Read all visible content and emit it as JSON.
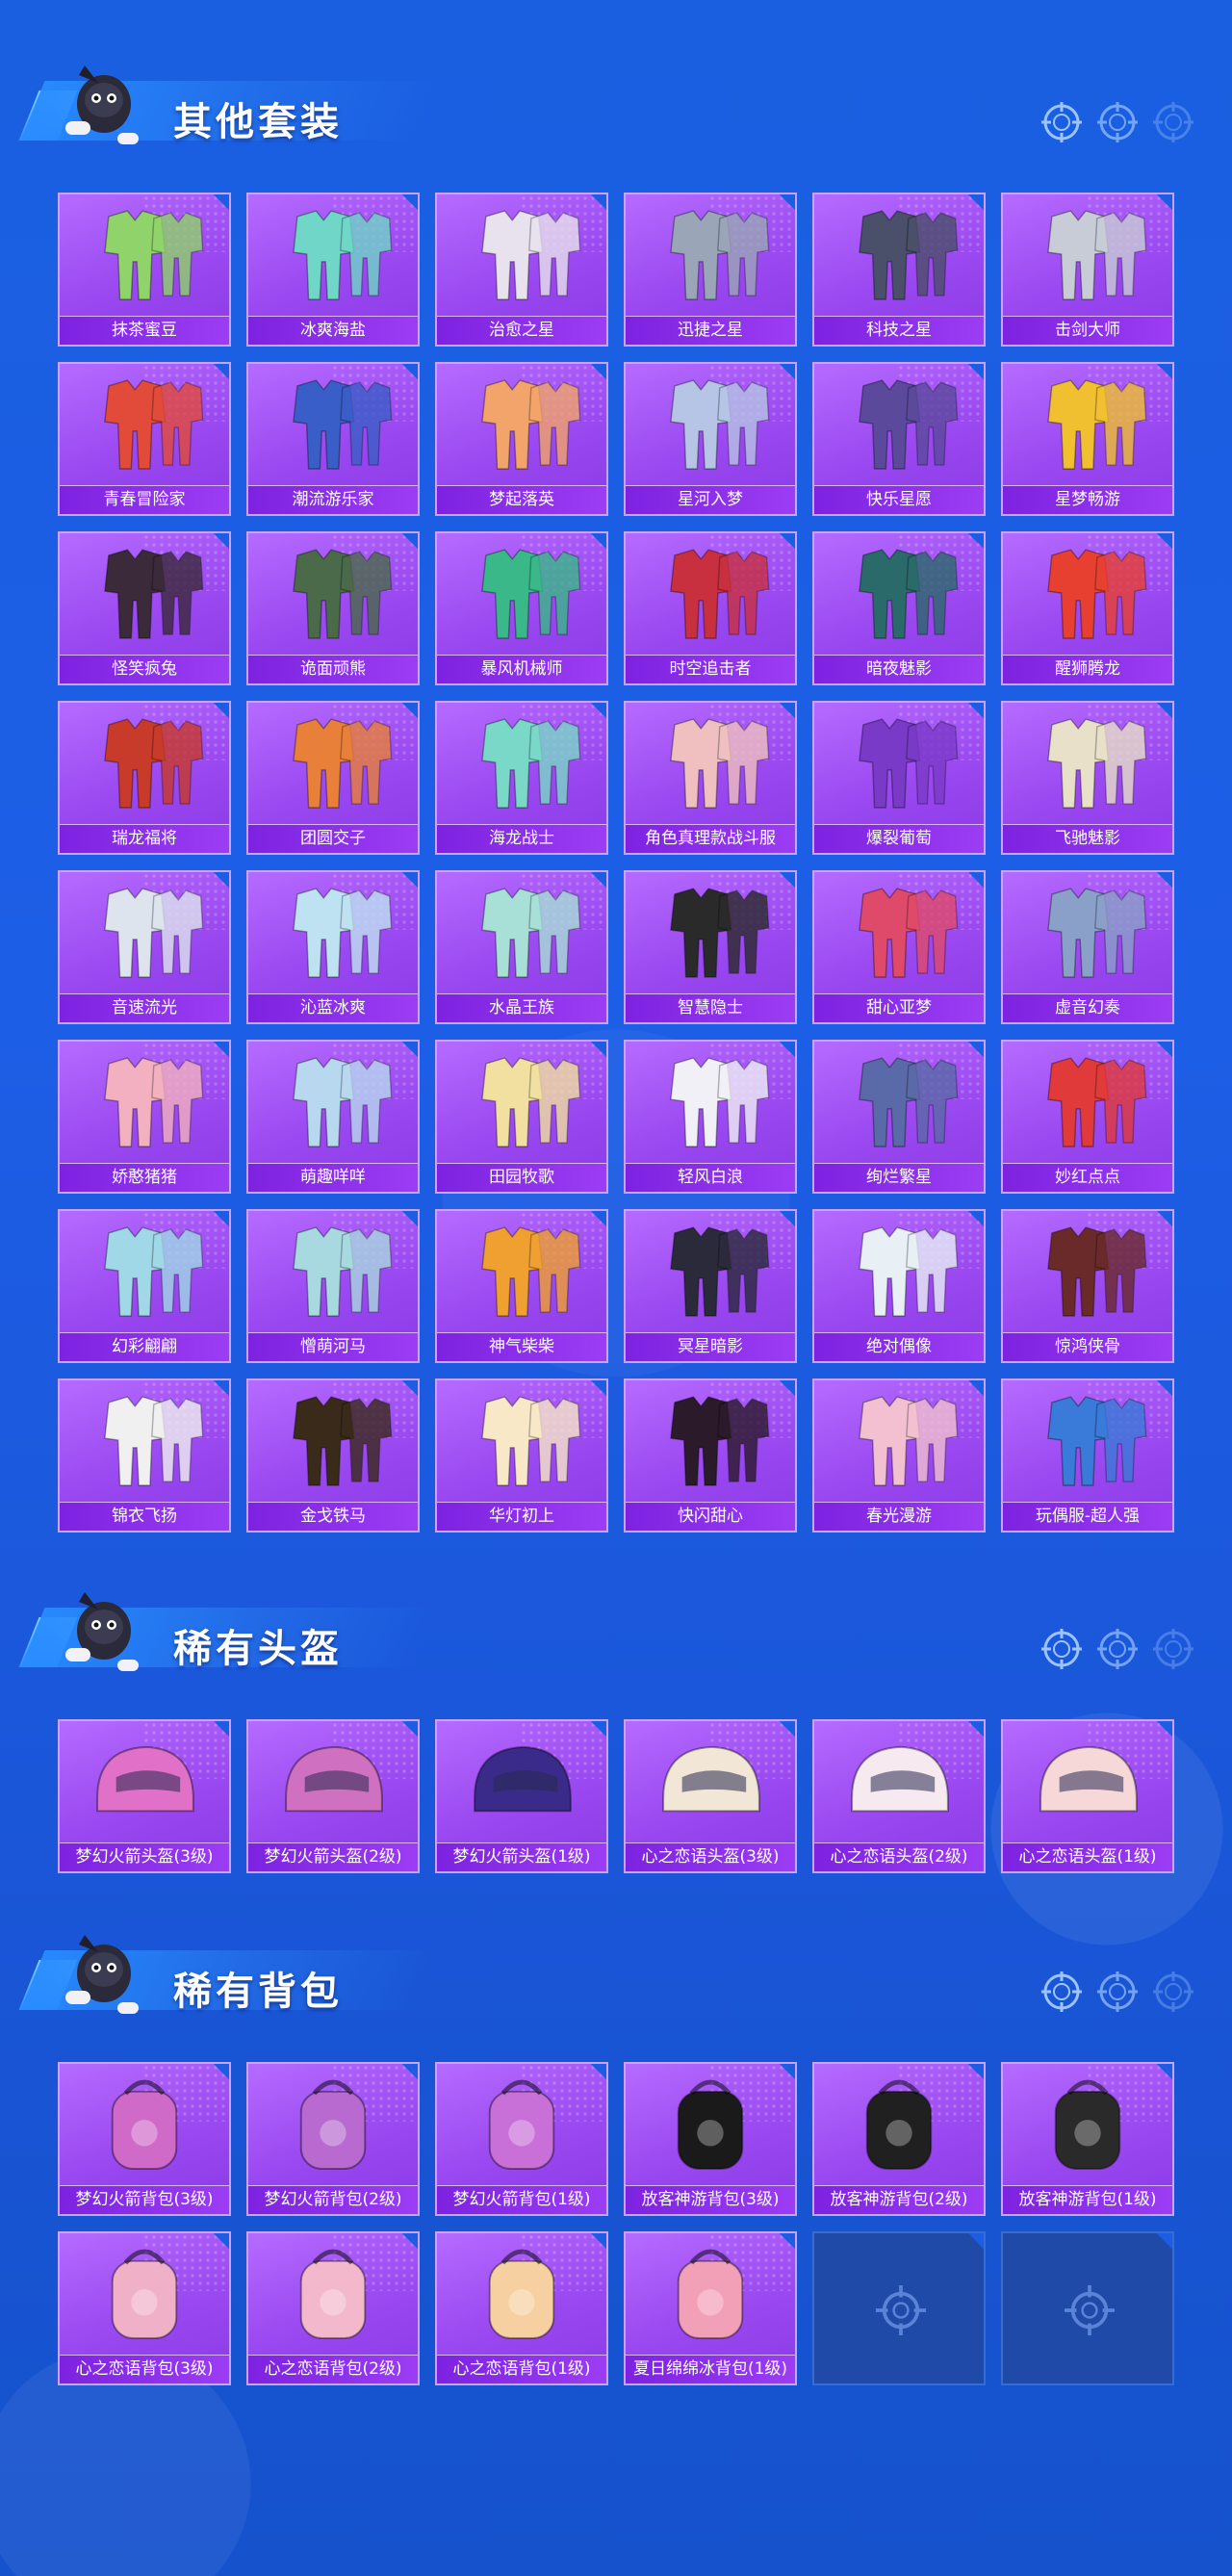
{
  "sections": [
    {
      "title": "其他套装",
      "items": [
        {
          "label": "抹茶蜜豆",
          "color": "#8fd36a"
        },
        {
          "label": "冰爽海盐",
          "color": "#6fd6c8"
        },
        {
          "label": "治愈之星",
          "color": "#e8e2ee"
        },
        {
          "label": "迅捷之星",
          "color": "#9aa6b8"
        },
        {
          "label": "科技之星",
          "color": "#4a4f6a"
        },
        {
          "label": "击剑大师",
          "color": "#c8ccd6"
        },
        {
          "label": "青春冒险家",
          "color": "#e24a3a"
        },
        {
          "label": "潮流游乐家",
          "color": "#3a5ec8"
        },
        {
          "label": "梦起落英",
          "color": "#f2a46a"
        },
        {
          "label": "星河入梦",
          "color": "#b6c4e6"
        },
        {
          "label": "快乐星愿",
          "color": "#5b4a9c"
        },
        {
          "label": "星梦畅游",
          "color": "#f0c030"
        },
        {
          "label": "怪笑疯兔",
          "color": "#3a2a3a"
        },
        {
          "label": "诡面顽熊",
          "color": "#4a6a4a"
        },
        {
          "label": "暴风机械师",
          "color": "#3ab88a"
        },
        {
          "label": "时空追击者",
          "color": "#c83040"
        },
        {
          "label": "暗夜魅影",
          "color": "#2a6a6a"
        },
        {
          "label": "醒狮腾龙",
          "color": "#e84030"
        },
        {
          "label": "瑞龙福将",
          "color": "#c83a2a"
        },
        {
          "label": "团圆交子",
          "color": "#e8803a"
        },
        {
          "label": "海龙战士",
          "color": "#7ad8c8"
        },
        {
          "label": "角色真理款战斗服",
          "color": "#f0c0c0"
        },
        {
          "label": "爆裂葡萄",
          "color": "#7a3ac8"
        },
        {
          "label": "飞驰魅影",
          "color": "#e8e0c8"
        },
        {
          "label": "音速流光",
          "color": "#dde4ee"
        },
        {
          "label": "沁蓝冰爽",
          "color": "#bfe2f2"
        },
        {
          "label": "水晶王族",
          "color": "#a8e0d8"
        },
        {
          "label": "智慧隐士",
          "color": "#2a2a2a"
        },
        {
          "label": "甜心亚梦",
          "color": "#e04a6a"
        },
        {
          "label": "虚音幻奏",
          "color": "#8aa0c8"
        },
        {
          "label": "娇憨猪猪",
          "color": "#f2b0c0"
        },
        {
          "label": "萌趣咩咩",
          "color": "#b8d8f0"
        },
        {
          "label": "田园牧歌",
          "color": "#f2e0a0"
        },
        {
          "label": "轻风白浪",
          "color": "#f0f0f6"
        },
        {
          "label": "绚烂繁星",
          "color": "#5a6aa8"
        },
        {
          "label": "妙红点点",
          "color": "#e03a3a"
        },
        {
          "label": "幻彩翩翩",
          "color": "#a0d8e8"
        },
        {
          "label": "憎萌河马",
          "color": "#a8d8e0"
        },
        {
          "label": "神气柴柴",
          "color": "#f0a030"
        },
        {
          "label": "冥星暗影",
          "color": "#2a2a3a"
        },
        {
          "label": "绝对偶像",
          "color": "#e8f0f6"
        },
        {
          "label": "惊鸿侠骨",
          "color": "#6a2a2a"
        },
        {
          "label": "锦衣飞扬",
          "color": "#f0f0f0"
        },
        {
          "label": "金戈铁马",
          "color": "#3a2a1a"
        },
        {
          "label": "华灯初上",
          "color": "#f8e8c8"
        },
        {
          "label": "快闪甜心",
          "color": "#2a1a2a"
        },
        {
          "label": "春光漫游",
          "color": "#f2c0d0"
        },
        {
          "label": "玩偶服-超人强",
          "color": "#3a7ad8"
        }
      ]
    },
    {
      "title": "稀有头盔",
      "items": [
        {
          "label": "梦幻火箭头盔(3级)",
          "color": "#e070c8"
        },
        {
          "label": "梦幻火箭头盔(2级)",
          "color": "#d070c0"
        },
        {
          "label": "梦幻火箭头盔(1级)",
          "color": "#3a2a8a"
        },
        {
          "label": "心之恋语头盔(3级)",
          "color": "#f2e6d6"
        },
        {
          "label": "心之恋语头盔(2级)",
          "color": "#f6eaf0"
        },
        {
          "label": "心之恋语头盔(1级)",
          "color": "#f6d8d8"
        }
      ]
    },
    {
      "title": "稀有背包",
      "items": [
        {
          "label": "梦幻火箭背包(3级)",
          "color": "#d06ac8"
        },
        {
          "label": "梦幻火箭背包(2级)",
          "color": "#b86ad0"
        },
        {
          "label": "梦幻火箭背包(1级)",
          "color": "#c870d8"
        },
        {
          "label": "放客神游背包(3级)",
          "color": "#1a1a1a"
        },
        {
          "label": "放客神游背包(2级)",
          "color": "#202020"
        },
        {
          "label": "放客神游背包(1级)",
          "color": "#2a2a2a"
        },
        {
          "label": "心之恋语背包(3级)",
          "color": "#f0b0c8"
        },
        {
          "label": "心之恋语背包(2级)",
          "color": "#f4b8cc"
        },
        {
          "label": "心之恋语背包(1级)",
          "color": "#f6d0a0"
        },
        {
          "label": "夏日绵绵冰背包(1级)",
          "color": "#f2a0b8"
        },
        {
          "label": "",
          "empty": true
        },
        {
          "label": "",
          "empty": true
        }
      ]
    }
  ]
}
